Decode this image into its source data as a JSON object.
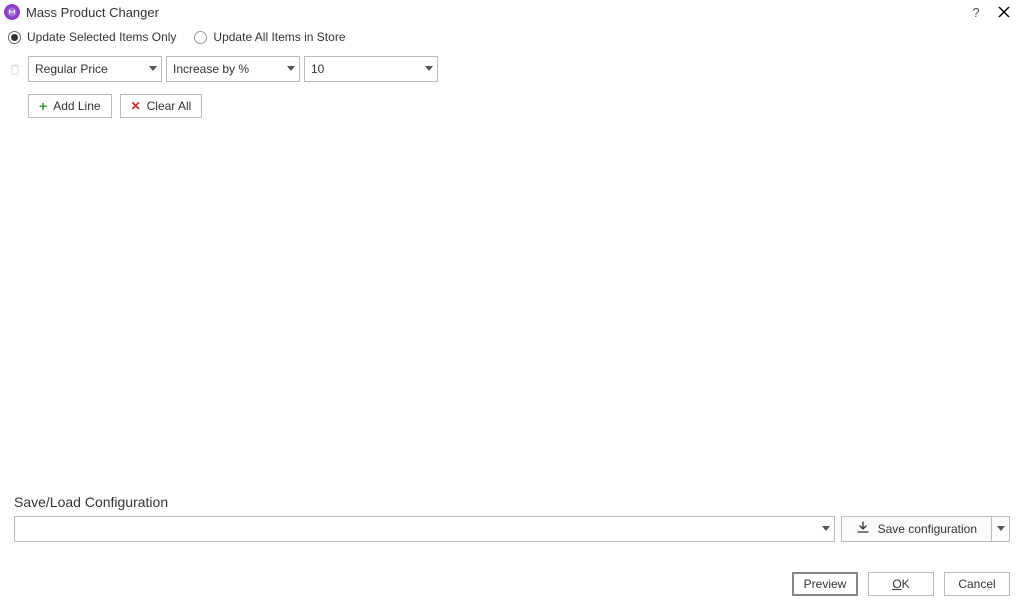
{
  "window": {
    "title": "Mass Product Changer",
    "help_tooltip": "?",
    "close_tooltip": "Close"
  },
  "scope": {
    "selected_only": "Update Selected Items Only",
    "all_in_store": "Update All Items in Store",
    "checked": "selected_only"
  },
  "line": {
    "field": "Regular Price",
    "action": "Increase by %",
    "value": "10"
  },
  "toolbar": {
    "add_line": "Add Line",
    "clear_all": "Clear All"
  },
  "saveload": {
    "heading": "Save/Load Configuration",
    "config_name": "",
    "save_button": "Save configuration"
  },
  "footer": {
    "preview": "Preview",
    "ok_prefix": "O",
    "ok_suffix": "K",
    "cancel": "Cancel"
  }
}
